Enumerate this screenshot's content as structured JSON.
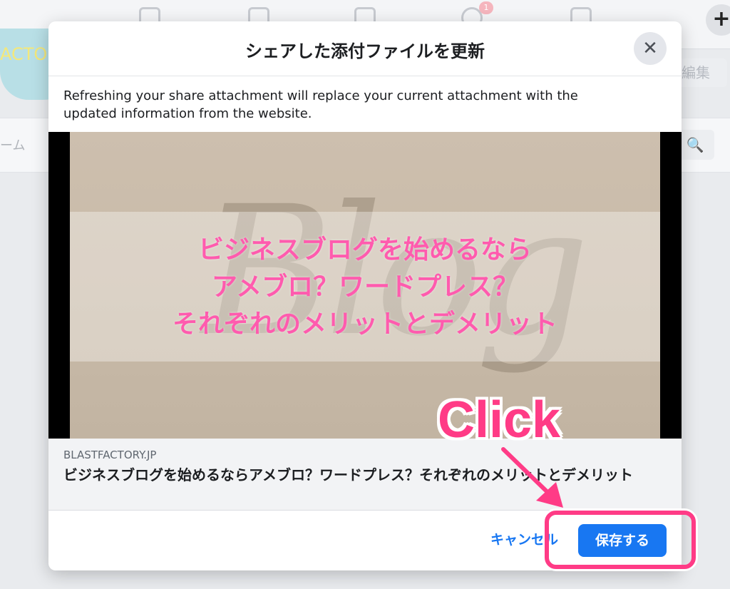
{
  "background": {
    "notification_count": "1",
    "cover_text": "ACTO",
    "edit_label": "編集",
    "tab_label": "ーム",
    "plus_label": "+"
  },
  "dialog": {
    "title": "シェアした添付ファイルを更新",
    "close_icon": "close-icon",
    "description": "Refreshing your share attachment will replace your current attachment with the updated information from the website.",
    "preview": {
      "image_text": "Blog",
      "lines": [
        "ビジネスブログを始めるなら",
        "アメブロ？ワードプレス？",
        "それぞれのメリットとデメリット"
      ]
    },
    "link": {
      "domain": "BLASTFACTORY.JP",
      "title": "ビジネスブログを始めるならアメブロ？ワードプレス？それぞれのメリットとデメリット"
    },
    "cancel_label": "キャンセル",
    "save_label": "保存する"
  },
  "annotation": {
    "click_label": "Click",
    "accent_color": "#ff3b86"
  },
  "colors": {
    "primary": "#1877f2",
    "preview_text": "#ff5bae"
  }
}
